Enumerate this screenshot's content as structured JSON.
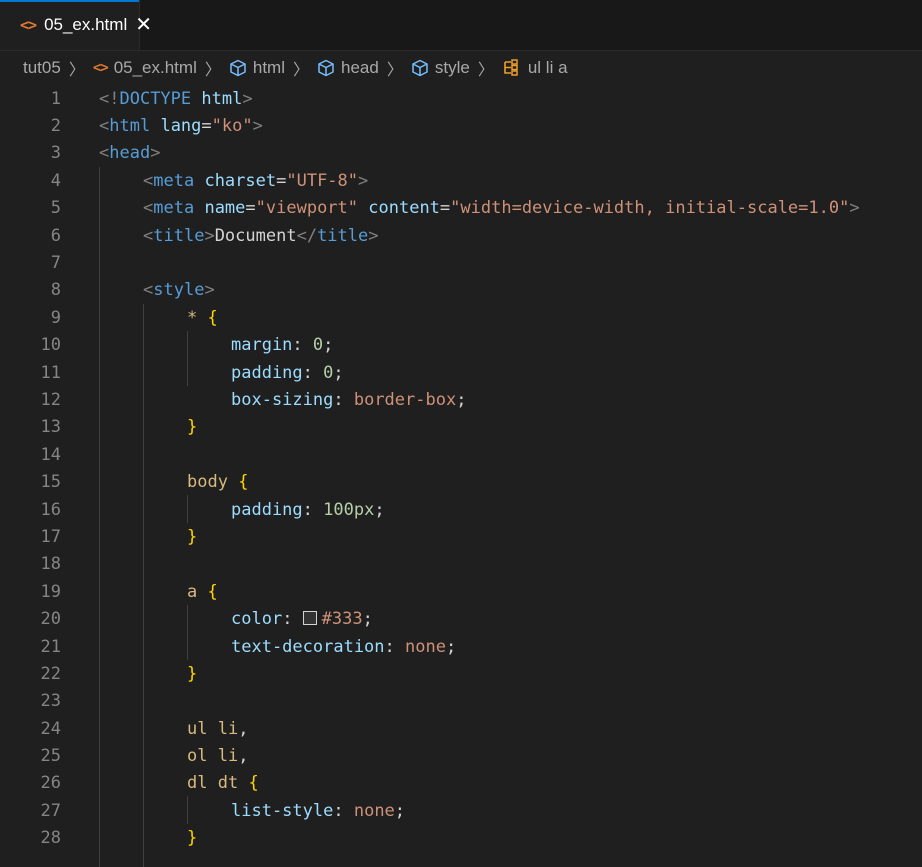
{
  "tab": {
    "title": "05_ex.html",
    "close": "✕"
  },
  "breadcrumbs": [
    "tut05",
    "05_ex.html",
    "html",
    "head",
    "style",
    "ul li a"
  ],
  "line_numbers": [
    "1",
    "2",
    "3",
    "4",
    "5",
    "6",
    "7",
    "8",
    "9",
    "10",
    "11",
    "12",
    "13",
    "14",
    "15",
    "16",
    "17",
    "18",
    "19",
    "20",
    "21",
    "22",
    "23",
    "24",
    "25",
    "26",
    "27",
    "28"
  ],
  "code": {
    "l1": [
      "<!",
      "DOCTYPE",
      " ",
      "html",
      ">"
    ],
    "l2": [
      "<",
      "html",
      " ",
      "lang",
      "=",
      "\"ko\"",
      ">"
    ],
    "l3": [
      "<",
      "head",
      ">"
    ],
    "l4": [
      "<",
      "meta",
      " ",
      "charset",
      "=",
      "\"UTF-8\"",
      ">"
    ],
    "l5": [
      "<",
      "meta",
      " ",
      "name",
      "=",
      "\"viewport\"",
      " ",
      "content",
      "=",
      "\"width=device-width, initial-scale=1.0\"",
      ">"
    ],
    "l6": [
      "<",
      "title",
      ">",
      "Document",
      "</",
      "title",
      ">"
    ],
    "l8": [
      "<",
      "style",
      ">"
    ],
    "l9": [
      "*",
      " ",
      "{"
    ],
    "l10": [
      "margin",
      ": ",
      "0",
      ";"
    ],
    "l11": [
      "padding",
      ": ",
      "0",
      ";"
    ],
    "l12": [
      "box-sizing",
      ": ",
      "border-box",
      ";"
    ],
    "l13": [
      "}"
    ],
    "l15": [
      "body",
      " ",
      "{"
    ],
    "l16": [
      "padding",
      ": ",
      "100px",
      ";"
    ],
    "l17": [
      "}"
    ],
    "l19": [
      "a",
      " ",
      "{"
    ],
    "l20": [
      "color",
      ": ",
      "#333",
      ";"
    ],
    "l21": [
      "text-decoration",
      ": ",
      "none",
      ";"
    ],
    "l22": [
      "}"
    ],
    "l24": [
      "ul li",
      ","
    ],
    "l25": [
      "ol li",
      ","
    ],
    "l26": [
      "dl dt",
      " ",
      "{"
    ],
    "l27": [
      "list-style",
      ": ",
      "none",
      ";"
    ],
    "l28": [
      "}"
    ]
  },
  "colors": {
    "tab_accent": "#0078d4",
    "html_icon": "#e37933",
    "swatch": "#333333"
  },
  "icons": [
    "html-file-icon",
    "close-icon",
    "chevron-right-icon",
    "cube-icon",
    "structure-icon"
  ]
}
